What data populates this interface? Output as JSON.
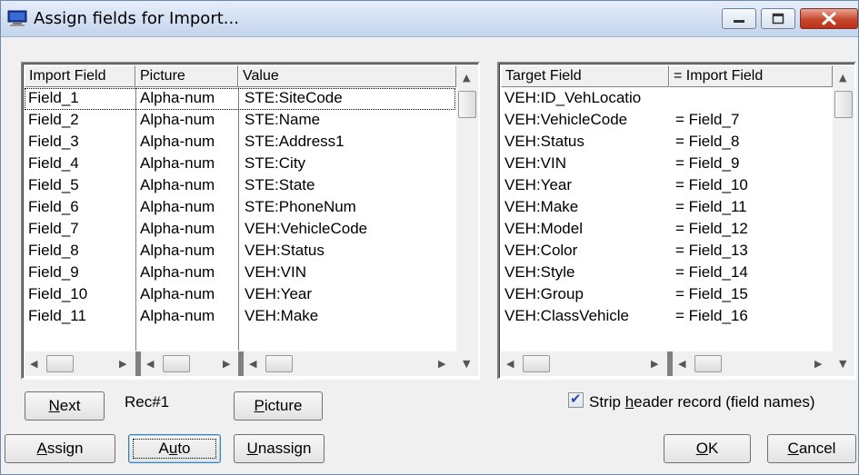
{
  "window": {
    "title": "Assign fields for Import..."
  },
  "left_list": {
    "headers": [
      "Import Field",
      "Picture",
      "Value"
    ],
    "rows": [
      [
        "Field_1",
        "Alpha-num",
        "STE:SiteCode"
      ],
      [
        "Field_2",
        "Alpha-num",
        "STE:Name"
      ],
      [
        "Field_3",
        "Alpha-num",
        "STE:Address1"
      ],
      [
        "Field_4",
        "Alpha-num",
        "STE:City"
      ],
      [
        "Field_5",
        "Alpha-num",
        "STE:State"
      ],
      [
        "Field_6",
        "Alpha-num",
        "STE:PhoneNum"
      ],
      [
        "Field_7",
        "Alpha-num",
        "VEH:VehicleCode"
      ],
      [
        "Field_8",
        "Alpha-num",
        "VEH:Status"
      ],
      [
        "Field_9",
        "Alpha-num",
        "VEH:VIN"
      ],
      [
        "Field_10",
        "Alpha-num",
        "VEH:Year"
      ],
      [
        "Field_11",
        "Alpha-num",
        "VEH:Make"
      ]
    ]
  },
  "right_list": {
    "headers": [
      "Target Field",
      "= Import Field"
    ],
    "rows": [
      [
        "VEH:ID_VehLocatio",
        ""
      ],
      [
        "VEH:VehicleCode",
        "= Field_7"
      ],
      [
        "VEH:Status",
        "= Field_8"
      ],
      [
        "VEH:VIN",
        "= Field_9"
      ],
      [
        "VEH:Year",
        "= Field_10"
      ],
      [
        "VEH:Make",
        "= Field_11"
      ],
      [
        "VEH:Model",
        "= Field_12"
      ],
      [
        "VEH:Color",
        "= Field_13"
      ],
      [
        "VEH:Style",
        "= Field_14"
      ],
      [
        "VEH:Group",
        "= Field_15"
      ],
      [
        "VEH:ClassVehicle",
        "= Field_16"
      ]
    ]
  },
  "buttons": {
    "next": {
      "pre": "",
      "u": "N",
      "post": "ext"
    },
    "picture": {
      "pre": "",
      "u": "P",
      "post": "icture"
    },
    "assign": {
      "pre": "",
      "u": "A",
      "post": "ssign"
    },
    "auto": {
      "pre": "A",
      "u": "u",
      "post": "to"
    },
    "unassign": {
      "pre": "",
      "u": "U",
      "post": "nassign"
    },
    "ok": {
      "pre": "",
      "u": "O",
      "post": "K"
    },
    "cancel": {
      "pre": "",
      "u": "C",
      "post": "ancel"
    }
  },
  "record_label": "Rec#1",
  "strip_header": {
    "checked": true,
    "pre": "Strip ",
    "u": "h",
    "post": "eader record (field names)"
  }
}
